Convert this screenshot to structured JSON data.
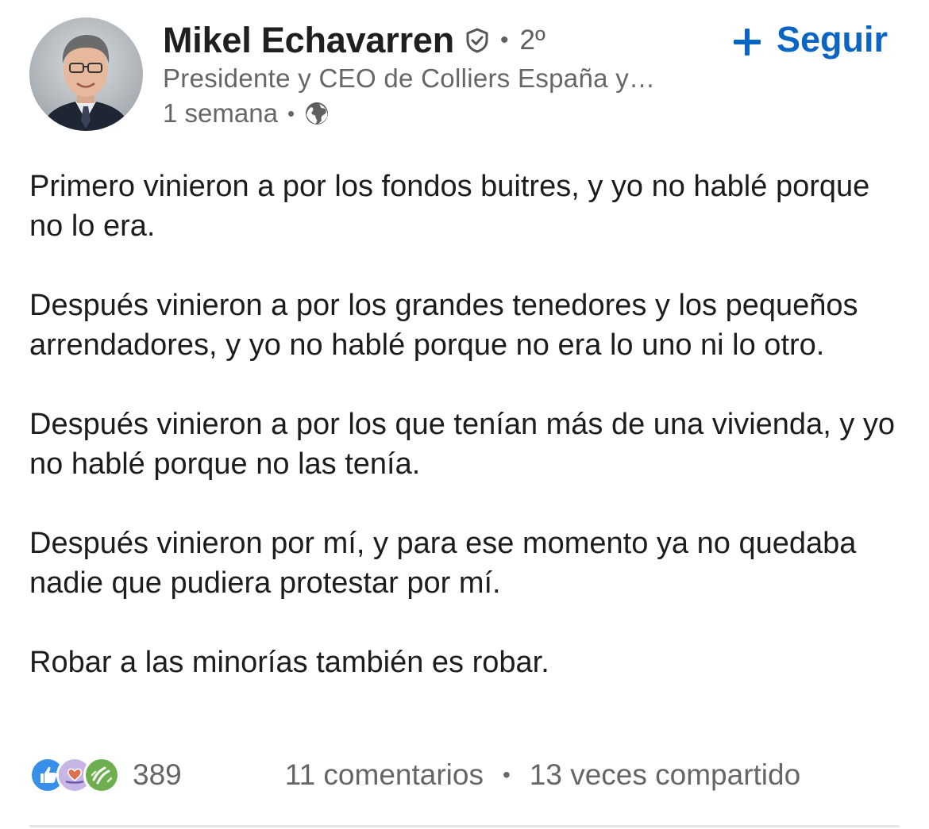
{
  "author": {
    "name": "Mikel Echavarren",
    "degree": "2º",
    "headline": "Presidente y CEO de Colliers España y…",
    "time": "1 semana",
    "visibility_icon": "globe-icon",
    "verified_icon": "verified-shield-icon"
  },
  "follow": {
    "label": "Seguir",
    "icon": "plus-icon",
    "color": "#0a66c2"
  },
  "post": {
    "paragraphs": [
      "Primero vinieron a por los fondos buitres, y yo no hablé porque no lo era.",
      "Después vinieron a por los grandes tenedores y los pequeños arrendadores, y yo no hablé porque no era lo uno ni lo otro.",
      "Después vinieron a por los que tenían más de una vivienda, y yo no hablé porque no las tenía.",
      "Después vinieron por mí, y para ese momento ya no quedaba nadie que pudiera protestar por mí.",
      "Robar a las minorías también es robar."
    ]
  },
  "social": {
    "reactions": [
      "like-reaction-icon",
      "love-reaction-icon",
      "celebrate-reaction-icon"
    ],
    "reaction_count": "389",
    "comments": "11 comentarios",
    "separator": "•",
    "shares": "13 veces compartido"
  }
}
